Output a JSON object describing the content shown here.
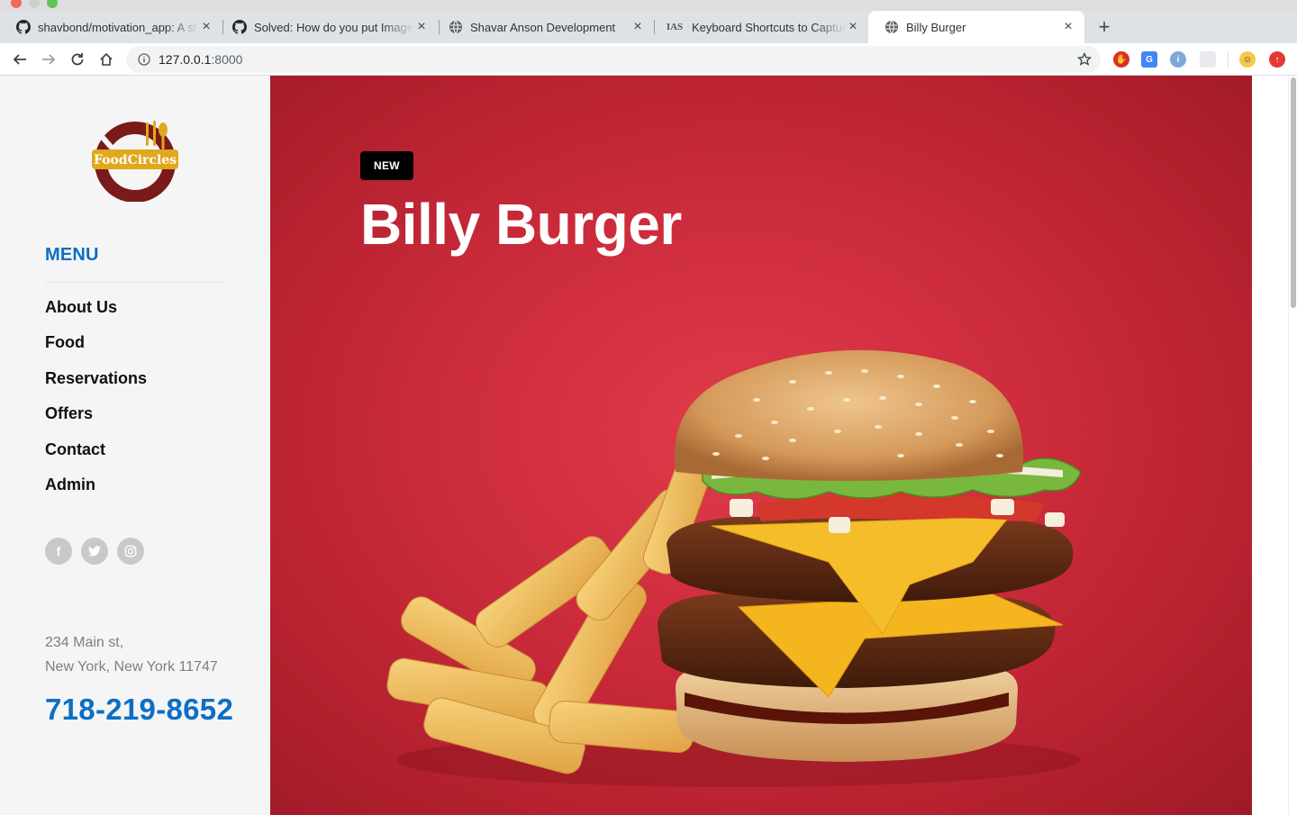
{
  "browser": {
    "tabs": [
      {
        "title": "shavbond/motivation_app: A sl",
        "icon": "github-icon"
      },
      {
        "title": "Solved: How do you put Image",
        "icon": "github-icon"
      },
      {
        "title": "Shavar Anson Development",
        "icon": "globe-icon"
      },
      {
        "title": "Keyboard Shortcuts to Capture",
        "icon": "ias-icon",
        "icon_text": "IAS"
      },
      {
        "title": "Billy Burger",
        "icon": "globe-icon",
        "active": true
      }
    ],
    "url_host": "127.0.0.1",
    "url_port": ":8000"
  },
  "sidebar": {
    "logo_text": "FoodCircles",
    "menu_heading": "MENU",
    "menu_items": [
      "About Us",
      "Food",
      "Reservations",
      "Offers",
      "Contact",
      "Admin"
    ],
    "social": [
      {
        "name": "facebook-icon",
        "glyph": "f"
      },
      {
        "name": "twitter-icon",
        "glyph": "t"
      },
      {
        "name": "instagram-icon",
        "glyph": "◎"
      }
    ],
    "address_line1": "234 Main st,",
    "address_line2": "New York, New York 11747",
    "phone": "718-219-8652"
  },
  "hero": {
    "badge": "NEW",
    "title": "Billy Burger"
  },
  "colors": {
    "accent": "#0d6ec4",
    "hero_red": "#cd2c3c",
    "sidebar_bg": "#f5f5f5"
  }
}
